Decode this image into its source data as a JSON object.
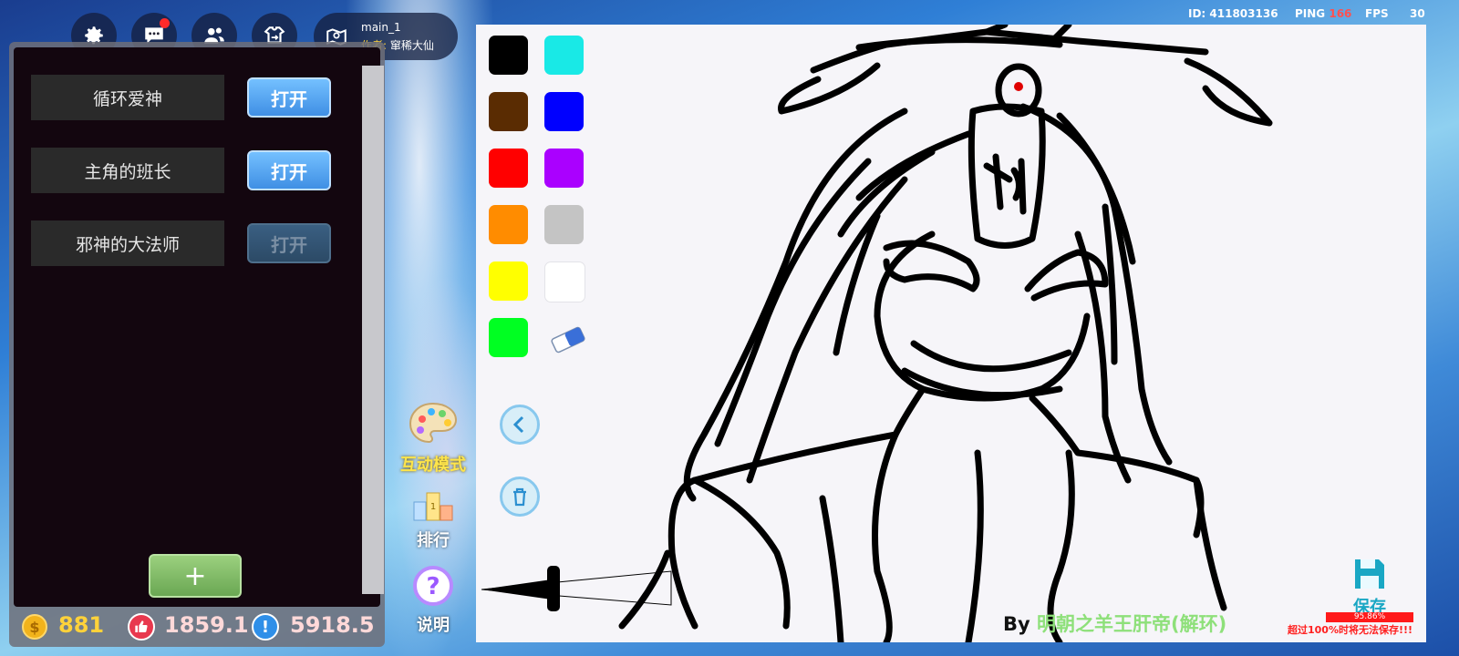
{
  "hud": {
    "id_label": "ID: 411803136",
    "ping_label": "PING",
    "ping_value": "166",
    "fps_label": "FPS",
    "fps_value": "30"
  },
  "map": {
    "name": "main_1",
    "author_label": "作者:",
    "author_name": "窜稀大仙"
  },
  "top_buttons": [
    "gear-icon",
    "chat-icon",
    "friends-icon",
    "swap-icon"
  ],
  "panel": {
    "items": [
      {
        "label": "循环爱神",
        "button": "打开",
        "enabled": true
      },
      {
        "label": "主角的班长",
        "button": "打开",
        "enabled": true
      },
      {
        "label": "邪神的大法师",
        "button": "打开",
        "enabled": false
      }
    ],
    "add_label": "+"
  },
  "stats": {
    "coins": "881",
    "likes": "1859.1",
    "points": "5918.5"
  },
  "side_tools": {
    "interactive": "互动模式",
    "ranking": "排行",
    "help": "说明"
  },
  "palette": {
    "colors": [
      "#000000",
      "#19e9e6",
      "#5a2c02",
      "#0000ff",
      "#ff0000",
      "#aa00ff",
      "#ff8c00",
      "#c4c4c4",
      "#ffff00",
      "#ffffff",
      "#00ff22"
    ]
  },
  "canvas": {
    "by_prefix": "By",
    "artist": "明朝之羊王肝帝(解环)",
    "save_label": "保存",
    "percent": "95.86%",
    "warning": "超过100%时将无法保存!!!"
  }
}
